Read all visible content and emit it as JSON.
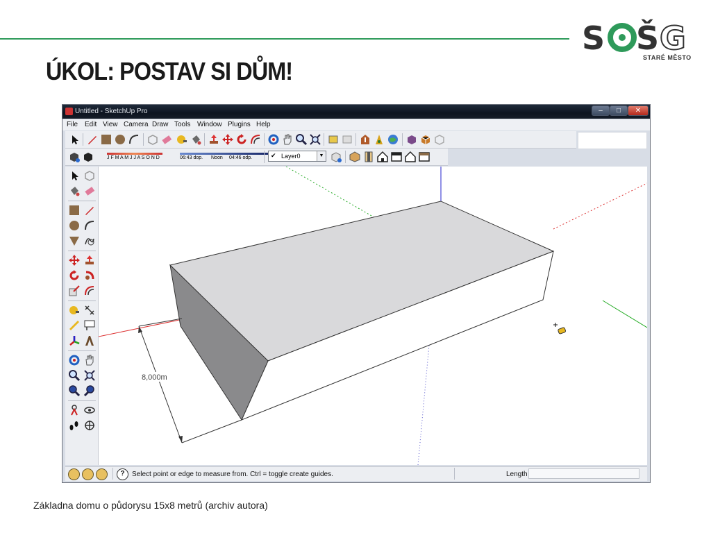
{
  "slide": {
    "title": "ÚKOL: POSTAV SI DŮM!",
    "caption": "Základna domu o půdorysu 15x8 metrů (archiv autora)",
    "logo_text": "SOŠG",
    "logo_sub": "STARÉ MĚSTO"
  },
  "window": {
    "title": "Untitled - SketchUp Pro",
    "minimize": "–",
    "maximize": "□",
    "close": "✕"
  },
  "menu": [
    "File",
    "Edit",
    "View",
    "Camera",
    "Draw",
    "Tools",
    "Window",
    "Plugins",
    "Help"
  ],
  "shadow": {
    "months": "J F M A M J J A S O N D",
    "time_start": "06:43 dop.",
    "time_noon": "Noon",
    "time_end": "04:46 odp."
  },
  "layer": {
    "check": "✔",
    "name": "Layer0"
  },
  "viewport": {
    "dimension_label": "8,000m"
  },
  "status": {
    "help_icon": "?",
    "text": "Select point or edge to measure from.  Ctrl = toggle create guides.",
    "length_label": "Length",
    "length_value": ""
  },
  "colors": {
    "accent_green": "#2e9a5a",
    "axis_red": "#d33",
    "axis_green": "#2a2",
    "axis_blue": "#22c",
    "box_top": "#d9d9db",
    "box_front": "#ffffff"
  }
}
